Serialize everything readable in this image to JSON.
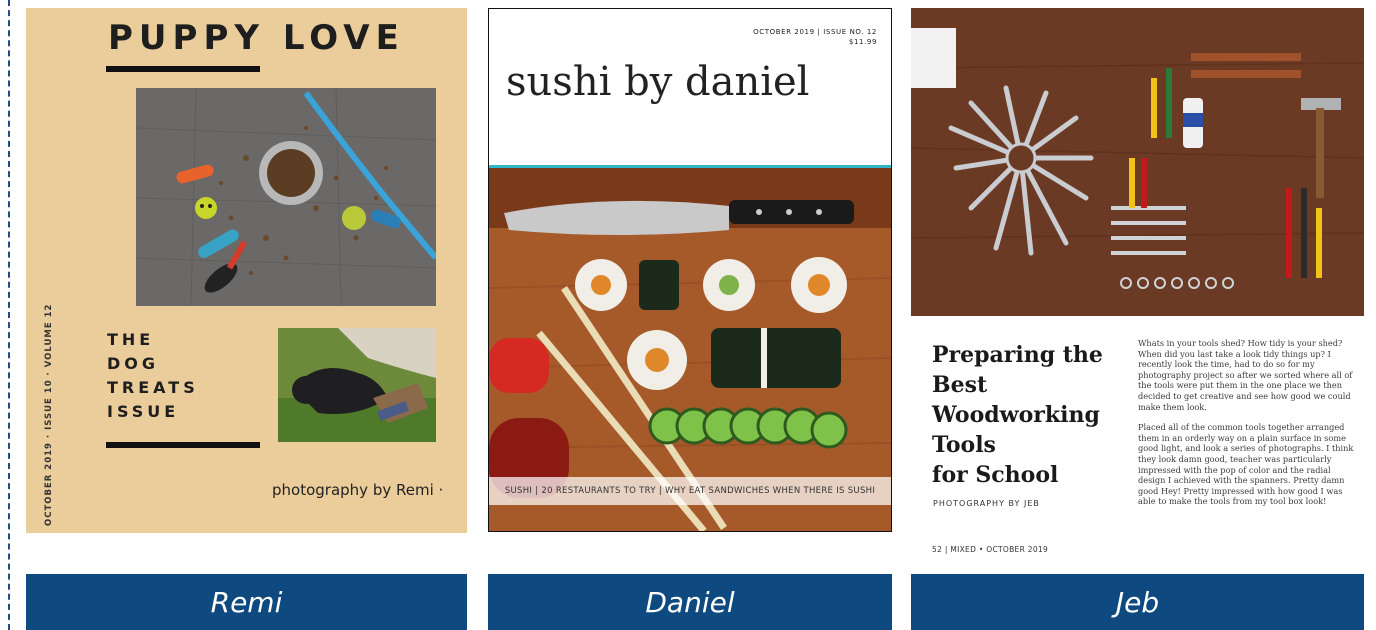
{
  "colors": {
    "caption_bar": "#0e4a7f",
    "dashed_border": "#1c4e8a",
    "puppy_background": "#ebcd9b",
    "sushi_accent": "#2fb6c7"
  },
  "cards": {
    "remi": {
      "caption": "Remi",
      "cover": {
        "title": "PUPPY LOVE",
        "issue_lines": [
          "THE",
          "DOG",
          "TREATS",
          "ISSUE"
        ],
        "credit": "photography by Remi ·",
        "vertical_text": "OCTOBER 2019 · ISSUE 10 · VOLUME 12",
        "photos": [
          "dog-treats-flatlay-photo",
          "puppy-on-grass-photo"
        ]
      }
    },
    "daniel": {
      "caption": "Daniel",
      "cover": {
        "meta_line1": "OCTOBER 2019 | ISSUE NO. 12",
        "meta_line2": "$11.99",
        "title": "sushi by daniel",
        "strip_text": "SUSHI  | 20 RESTAURANTS TO TRY | WHY EAT SANDWICHES WHEN THERE IS SUSHI",
        "photos": [
          "sushi-knife-board-photo"
        ]
      }
    },
    "jeb": {
      "caption": "Jeb",
      "cover": {
        "headline": [
          "Preparing the",
          "Best",
          "Woodworking",
          "Tools",
          "for School"
        ],
        "byline": "PHOTOGRAPHY BY JEB",
        "footer": "52 | MIXED • OCTOBER 2019",
        "body_paragraphs": [
          "Whats in your tools shed? How tidy is your shed? When did you last take a look tidy things up? I recently look the time, had to do so for my photography project so after we sorted where all of the tools were put them in the one place we then decided to get creative and see how good we could make them look.",
          "Placed all of the common tools together arranged them in an orderly way  on a plain surface in some good light, and look a series of photographs. I think they look damn good, teacher was particularly impressed with the pop of color and the radial design I achieved with the spanners. Pretty damn good Hey! Pretty impressed with how good I was able to make the tools from my tool box look!"
        ],
        "photos": [
          "woodworking-tools-radial-photo"
        ]
      }
    }
  }
}
